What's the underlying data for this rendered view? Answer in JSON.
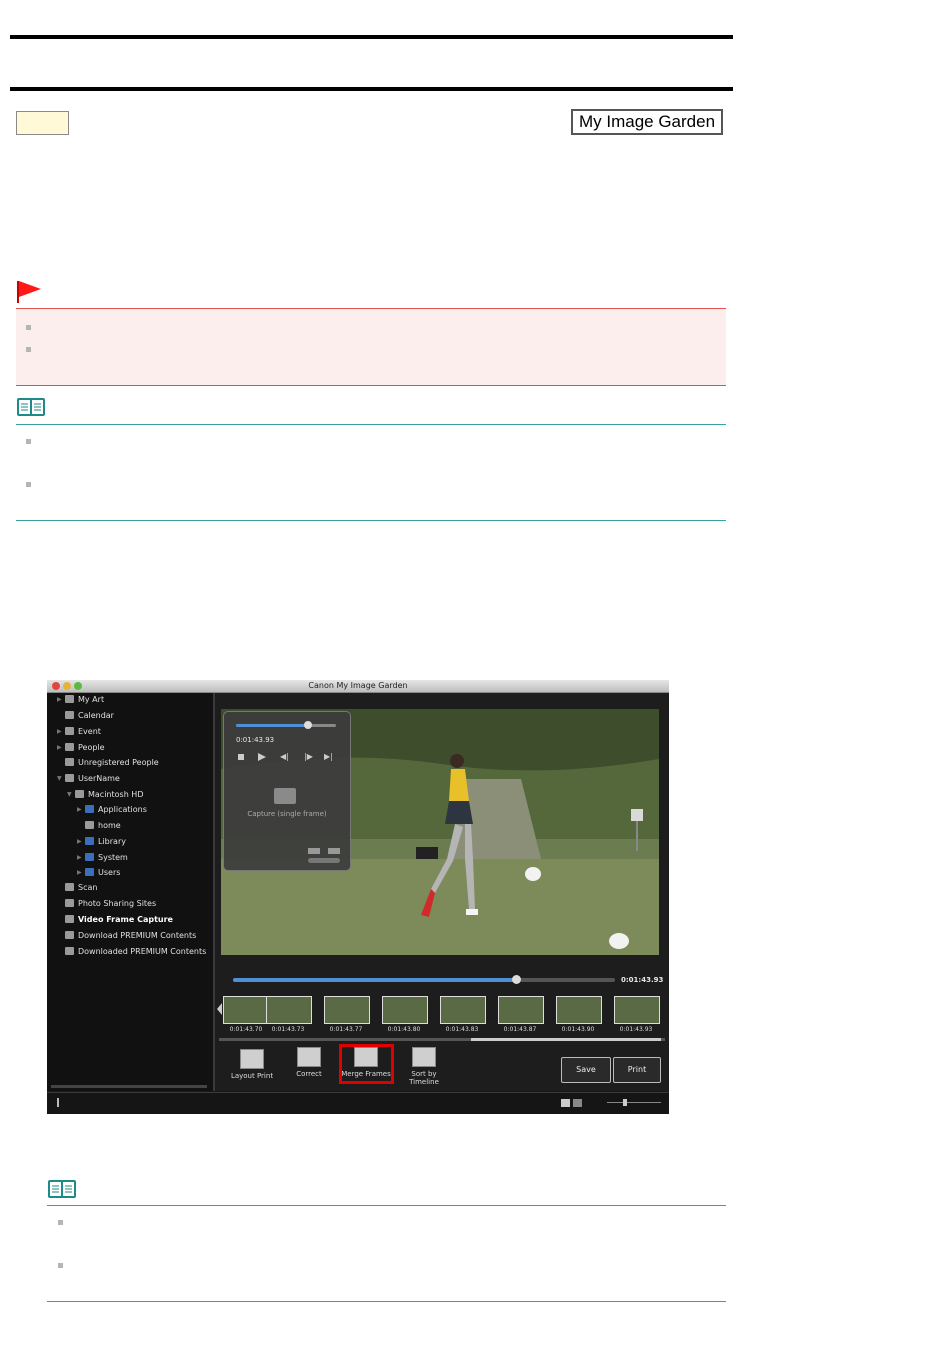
{
  "header": {
    "brand_label": "My Image Garden"
  },
  "screenshot": {
    "window_title": "Canon My Image Garden",
    "sidebar": [
      {
        "label": "My Art",
        "icon": "art-icon"
      },
      {
        "label": "Calendar",
        "icon": "calendar-icon"
      },
      {
        "label": "Event",
        "icon": "event-icon"
      },
      {
        "label": "People",
        "icon": "people-icon"
      },
      {
        "label": "Unregistered People",
        "icon": "person-icon"
      },
      {
        "label": "UserName",
        "icon": "computer-icon"
      },
      {
        "label": "Macintosh HD",
        "icon": "drive-icon"
      },
      {
        "label": "Applications",
        "icon": "folder-icon"
      },
      {
        "label": "home",
        "icon": "home-icon"
      },
      {
        "label": "Library",
        "icon": "folder-icon"
      },
      {
        "label": "System",
        "icon": "folder-icon"
      },
      {
        "label": "Users",
        "icon": "folder-icon"
      },
      {
        "label": "Scan",
        "icon": "scan-icon"
      },
      {
        "label": "Photo Sharing Sites",
        "icon": "share-icon"
      },
      {
        "label": "Video Frame Capture",
        "icon": "film-icon"
      },
      {
        "label": "Download PREMIUM Contents",
        "icon": "download-icon"
      },
      {
        "label": "Downloaded PREMIUM Contents",
        "icon": "folder-icon"
      }
    ],
    "panel_time": "0:01:43.93",
    "capture_label": "Capture (single frame)",
    "current_time": "0:01:43.93",
    "scrub_progress": 0.74,
    "thumbnail_times": [
      "0:01:43.70",
      "0:01:43.73",
      "0:01:43.77",
      "0:01:43.80",
      "0:01:43.83",
      "0:01:43.87",
      "0:01:43.90",
      "0:01:43.93"
    ],
    "tools": {
      "layout_print": "Layout Print",
      "correct": "Correct",
      "merge_frames": "Merge Frames",
      "sort_by_timeline": "Sort by Timeline"
    },
    "buttons": {
      "save": "Save",
      "print": "Print"
    },
    "highlight_color": "#e00000"
  }
}
